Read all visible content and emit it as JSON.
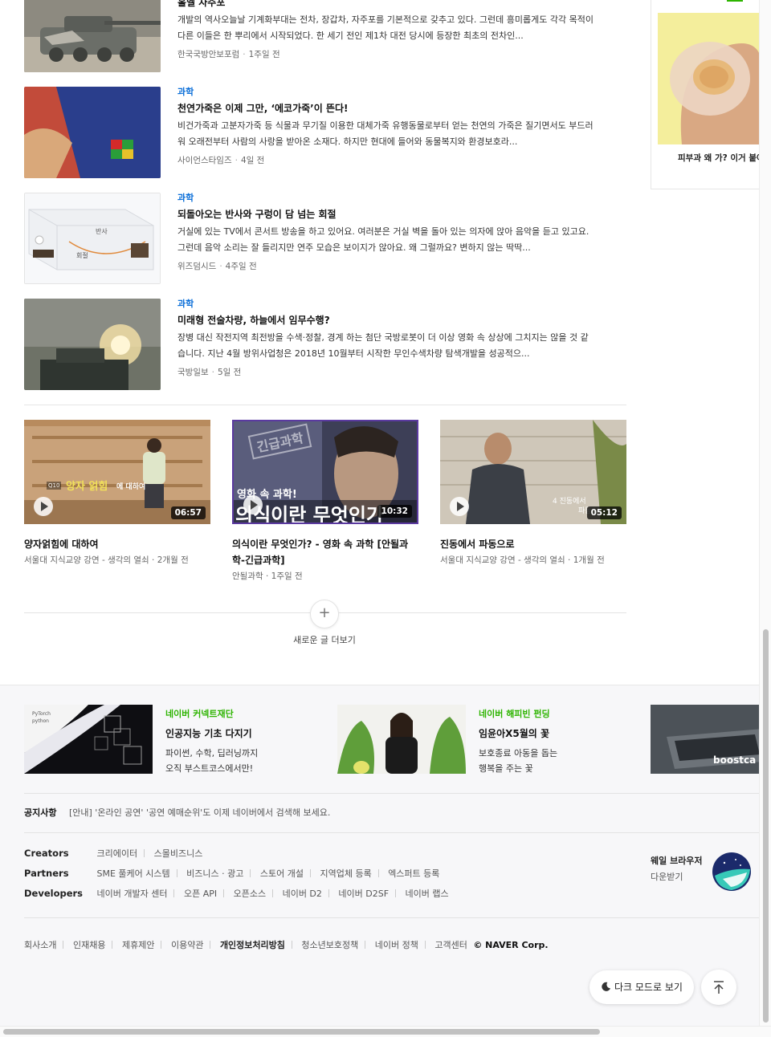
{
  "news": [
    {
      "category": "",
      "title": "홀멜 자주포",
      "body": "개발의 역사오늘날 기계화부대는 전차, 장갑차, 자주포를 기본적으로 갖추고 있다. 그런데 흥미롭게도 각각 목적이 다른 이들은 한 뿌리에서 시작되었다. 한 세기 전인 제1차 대전 당시에 등장한 최초의 전차인...",
      "source": "한국국방안보포럼",
      "time": "1주일 전"
    },
    {
      "category": "과학",
      "title": "천연가죽은 이제 그만, ‘에코가죽’이 뜬다!",
      "body": "비건가죽과 고분자가죽 등 식물과 무기질 이용한 대체가죽 유행동물로부터 얻는 천연의 가죽은 질기면서도 부드러워 오래전부터 사람의 사랑을 받아온 소재다. 하지만 현대에 들어와 동물복지와 환경보호라...",
      "source": "사이언스타임즈",
      "time": "4일 전"
    },
    {
      "category": "과학",
      "title": "되돌아오는 반사와 구렁이 담 넘는 회절",
      "body": "거실에 있는 TV에서 콘서트 방송을 하고 있어요. 여러분은 거실 벽을 돌아 있는 의자에 앉아 음악을 듣고 있고요. 그런데 음악 소리는 잘 들리지만 연주 모습은 보이지가 않아요. 왜 그럴까요? 변하지 않는 딱딱...",
      "source": "위즈덤시드",
      "time": "4주일 전",
      "thumb_labels": [
        "반사",
        "회절"
      ]
    },
    {
      "category": "과학",
      "title": "미래형 전술차량, 하늘에서 임무수행?",
      "body": "장병 대신 작전지역 최전방을 수색·정찰, 경계 하는 첨단 국방로봇이 더 이상 영화 속 상상에 그치지는 않을 것 같습니다. 지난 4월 방위사업청은 2018년 10월부터 시작한 무인수색차량 탐색개발을 성공적으...",
      "source": "국방일보",
      "time": "5일 전"
    }
  ],
  "videos": [
    {
      "title": "양자얽힘에 대하여",
      "source": "서울대 지식교양 강연 - 생각의 열쇠",
      "time": "2개월 전",
      "duration": "06:57",
      "overlay_badge": "Q10",
      "overlay_text": "양자 얽힘",
      "overlay_suffix": "에 대하여"
    },
    {
      "title": "의식이란 무엇인가? - 영화 속 과학 [안될과학-긴급과학]",
      "source": "안될과학",
      "time": "1주일 전",
      "duration": "10:32",
      "overlay_stamp": "긴급과학",
      "overlay_small": "영화 속 과학!",
      "overlay_big": "의식이란 무엇인가"
    },
    {
      "title": "진동에서 파동으로",
      "source": "서울대 지식교양 강연 - 생각의 열쇠",
      "time": "1개월 전",
      "duration": "05:12",
      "overlay_text": "4 진동에서",
      "overlay_text2": "파동"
    }
  ],
  "more_label": "새로운 글 더보기",
  "more_icon": "plus-icon",
  "side_widget": {
    "caption": "피부과 왜 가? 이거 붙여"
  },
  "promos": [
    {
      "org": "네이버 커넥트재단",
      "title": "인공지능 기초 다지기",
      "desc": [
        "파이썬, 수학, 딥러닝까지",
        "오직 부스트코스에서만!"
      ],
      "img_labels": [
        "PyTorch",
        "python"
      ]
    },
    {
      "org": "네이버 해피빈 펀딩",
      "title": "임윤아X5월의 꽃",
      "desc": [
        "보호종료 아동을 돕는",
        "행복을 주는 꽃"
      ]
    },
    {
      "img_label": "boostca"
    }
  ],
  "notice": {
    "label": "공지사항",
    "text": "[안내] '온라인 공연' '공연 예매순위'도 이제 네이버에서 검색해 보세요."
  },
  "footer_links": {
    "creators": {
      "label": "Creators",
      "items": [
        "크리에이터",
        "스몰비즈니스"
      ]
    },
    "partners": {
      "label": "Partners",
      "items": [
        "SME 풀케어 시스템",
        "비즈니스 · 광고",
        "스토어 개설",
        "지역업체 등록",
        "엑스퍼트 등록"
      ]
    },
    "developers": {
      "label": "Developers",
      "items": [
        "네이버 개발자 센터",
        "오픈 API",
        "오픈소스",
        "네이버 D2",
        "네이버 D2SF",
        "네이버 랩스"
      ]
    }
  },
  "whale": {
    "line1": "웨일 브라우저",
    "line2": "다운받기",
    "icon": "whale-browser-icon"
  },
  "bottom_links": [
    "회사소개",
    "인재채용",
    "제휴제안",
    "이용약관",
    "개인정보처리방침",
    "청소년보호정책",
    "네이버 정책",
    "고객센터"
  ],
  "corp": "© NAVER Corp.",
  "dark_mode_label": "다크 모드로 보기",
  "colors": {
    "category": "#0a6ed8",
    "promo_org": "#2db400",
    "footer_bg": "#f7f7f9"
  }
}
